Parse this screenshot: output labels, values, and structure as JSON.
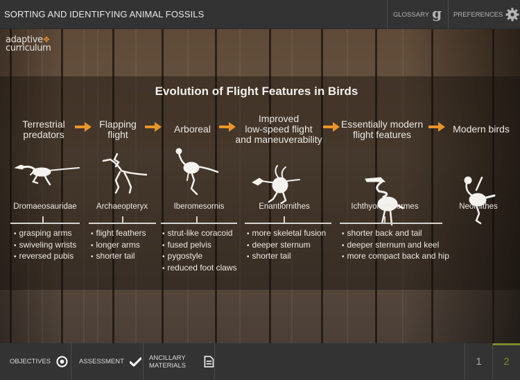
{
  "header": {
    "title": "SORTING AND IDENTIFYING ANIMAL FOSSILS",
    "glossary_label": "GLOSSARY",
    "glossary_icon": "g-icon",
    "preferences_label": "PREFERENCES",
    "preferences_icon": "gear-icon"
  },
  "logo": {
    "line1": "adaptive",
    "line2": "curriculum"
  },
  "diagram": {
    "title": "Evolution of Flight Features in Birds",
    "accent_color": "#e8952a",
    "stages": [
      {
        "label": "Terrestrial predators"
      },
      {
        "label": "Flapping flight"
      },
      {
        "label": "Arboreal"
      },
      {
        "label": "Improved low-speed flight and maneuverability"
      },
      {
        "label": "Essentially modern flight features"
      },
      {
        "label": "Modern birds"
      }
    ],
    "stage_lines": [
      [
        "Terrestrial",
        "predators"
      ],
      [
        "Flapping",
        "flight"
      ],
      [
        "Arboreal"
      ],
      [
        "Improved",
        "low-speed flight",
        "and maneuverability"
      ],
      [
        "Essentially modern",
        "flight features"
      ],
      [
        "Modern birds"
      ]
    ],
    "species": [
      {
        "name": "Dromaeosauridae",
        "traits": [
          "grasping arms",
          "swiveling wrists",
          "reversed pubis"
        ]
      },
      {
        "name": "Archaeopteryx",
        "traits": [
          "flight feathers",
          "longer arms",
          "shorter tail"
        ]
      },
      {
        "name": "Iberomesornis",
        "traits": [
          "strut-like coracoid",
          "fused pelvis",
          "pygostyle",
          "reduced foot claws"
        ]
      },
      {
        "name": "Enantiornithes",
        "traits": [
          "more skeletal fusion",
          "deeper sternum",
          "shorter tail"
        ]
      },
      {
        "name": "Ichthyornithiformes",
        "traits": [
          "shorter back and tail",
          "deeper sternum and keel",
          "more compact back and hip"
        ]
      },
      {
        "name": "Neornithes",
        "traits": []
      }
    ]
  },
  "footer": {
    "objectives_label": "OBJECTIVES",
    "assessment_label": "ASSESSMENT",
    "ancillary_line1": "ANCILLARY",
    "ancillary_line2": "MATERIALS",
    "pages": [
      "1",
      "2"
    ],
    "current_page": "2",
    "active_color": "#7c8a2a"
  }
}
